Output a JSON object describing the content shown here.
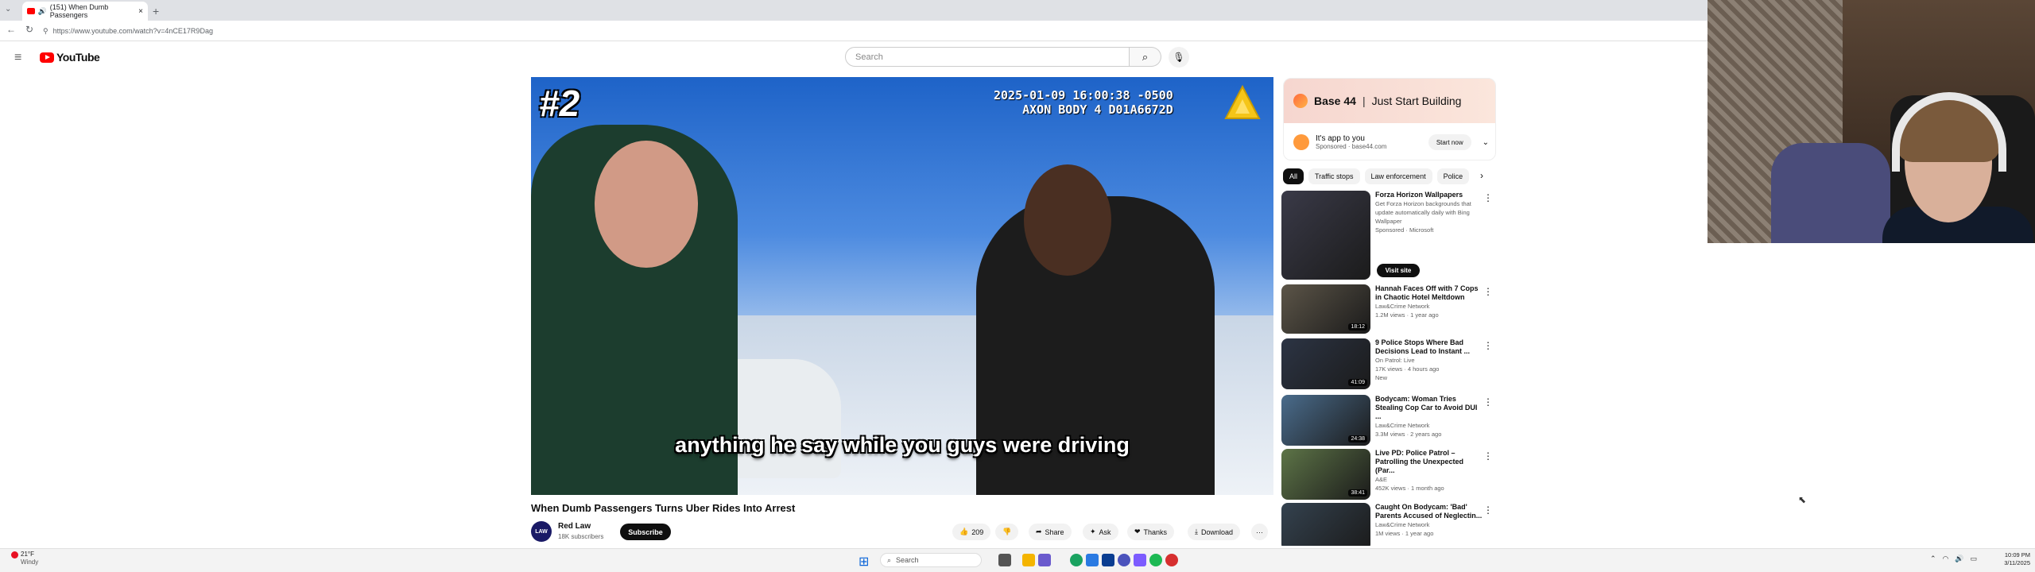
{
  "browser": {
    "tab_title": "(151) When Dumb Passengers",
    "tab_close": "×",
    "new_tab": "+",
    "url": "https://www.youtube.com/watch?v=4nCE17R9Dag"
  },
  "youtube": {
    "logo_text": "YouTube",
    "search_placeholder": "Search"
  },
  "video": {
    "rank_badge": "#2",
    "timestamp_line1": "2025-01-09 16:00:38 -0500",
    "timestamp_line2": "AXON BODY 4 D01A6672D",
    "subtitle": "anything he say while you guys were driving",
    "title": "When Dumb Passengers Turns Uber Rides Into Arrest"
  },
  "channel": {
    "avatar_text": "LAW",
    "name": "Red Law",
    "subscribers": "18K subscribers",
    "subscribe_label": "Subscribe"
  },
  "actions": {
    "likes": "209",
    "share": "Share",
    "ask": "Ask",
    "thanks": "Thanks",
    "download": "Download",
    "more": "···"
  },
  "ad": {
    "brand": "Base 44",
    "separator": "|",
    "tagline": "Just Start Building",
    "line1": "It's app to you",
    "line2": "Sponsored · base44.com",
    "cta": "Start now"
  },
  "chips": [
    "All",
    "Traffic stops",
    "Law enforcement",
    "Police"
  ],
  "recommendations": [
    {
      "title": "Forza Horizon Wallpapers",
      "line2": "Get Forza Horizon backgrounds that update automatically daily with Bing Wallpaper",
      "line3": "Sponsored · Microsoft",
      "duration": "",
      "thumb_color": "#3a3a48"
    },
    {
      "title": "Hannah Faces Off with 7 Cops in Chaotic Hotel Meltdown",
      "line2": "Law&Crime Network",
      "line3": "1.2M views · 1 year ago",
      "duration": "18:12",
      "thumb_color": "#5c5548"
    },
    {
      "title": "9 Police Stops Where Bad Decisions Lead to Instant ...",
      "line2": "On Patrol: Live",
      "line3": "17K views · 4 hours ago",
      "line4": "New",
      "duration": "41:09",
      "thumb_color": "#2c3444"
    },
    {
      "title": "Bodycam: Woman Tries Stealing Cop Car to Avoid DUI ...",
      "line2": "Law&Crime Network",
      "line3": "3.3M views · 2 years ago",
      "duration": "24:38",
      "thumb_color": "#4a6c8c"
    },
    {
      "title": "Live PD: Police Patrol – Patrolling the Unexpected (Par...",
      "line2": "A&E",
      "line3": "452K views · 1 month ago",
      "duration": "38:41",
      "thumb_color": "#5d7447"
    },
    {
      "title": "Caught On Bodycam: 'Bad' Parents Accused of Neglectin...",
      "line2": "Law&Crime Network",
      "line3": "1M views · 1 year ago",
      "duration": "",
      "thumb_color": "#34424f"
    }
  ],
  "visit_site": "Visit site",
  "taskbar": {
    "temp": "21°F",
    "condition": "Windy",
    "search": "Search",
    "time": "10:09 PM",
    "date": "3/11/2025"
  },
  "colors": {
    "youtube_red": "#ff0000",
    "accent_black": "#0f0f0f",
    "windows_blue": "#0a64d8"
  }
}
